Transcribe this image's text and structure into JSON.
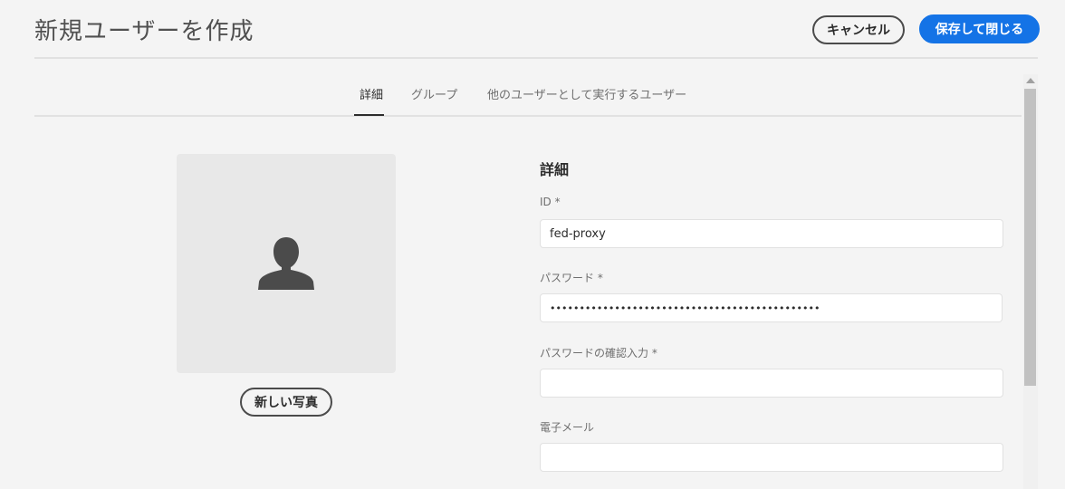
{
  "header": {
    "title": "新規ユーザーを作成",
    "cancel_label": "キャンセル",
    "save_label": "保存して閉じる"
  },
  "tabs": [
    {
      "label": "詳細",
      "active": true
    },
    {
      "label": "グループ",
      "active": false
    },
    {
      "label": "他のユーザーとして実行するユーザー",
      "active": false
    }
  ],
  "photo": {
    "avatar_icon": "user-silhouette-icon",
    "new_photo_label": "新しい写真"
  },
  "form": {
    "section_title": "詳細",
    "fields": [
      {
        "label": "ID *",
        "value": "fed-proxy"
      },
      {
        "label": "パスワード *",
        "value": "••••••••••••••••••••••••••••••••••••••••••••••"
      },
      {
        "label": "パスワードの確認入力 *",
        "value": ""
      },
      {
        "label": "電子メール",
        "value": ""
      }
    ]
  },
  "colors": {
    "accent": "#1473e6",
    "background": "#f4f4f4",
    "text": "#2c2c2c"
  }
}
